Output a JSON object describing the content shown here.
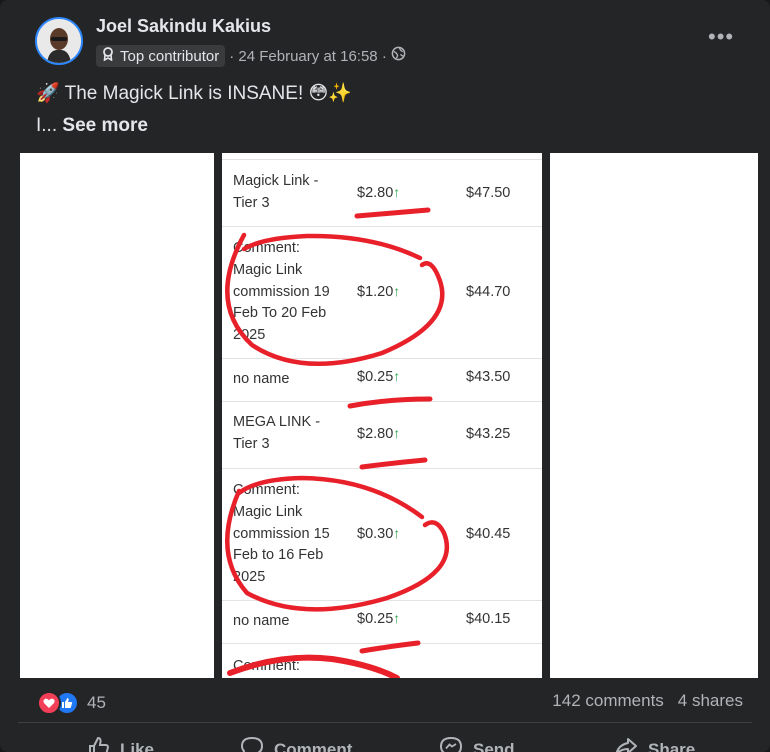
{
  "post": {
    "author": "Joel Sakindu Kakius",
    "badge": "Top contributor",
    "timestamp": "· 24 February at 16:58 ·",
    "text_line1": "🚀 The Magick Link is INSANE! 😳✨",
    "text_line2_prefix": "I... ",
    "see_more": "See more"
  },
  "screenshot_table": {
    "rows": [
      {
        "desc": "Magick Link -\nTier 3",
        "amount": "$2.80",
        "balance": "$47.50"
      },
      {
        "desc": "Comment:\nMagic Link\ncommission 19\nFeb To 20 Feb\n2025",
        "amount": "$1.20",
        "balance": "$44.70"
      },
      {
        "desc": "no name",
        "amount": "$0.25",
        "balance": "$43.50"
      },
      {
        "desc": "MEGA LINK -\nTier 3",
        "amount": "$2.80",
        "balance": "$43.25"
      },
      {
        "desc": "Comment:\nMagic Link\ncommission 15\nFeb to 16 Feb\n2025",
        "amount": "$0.30",
        "balance": "$40.45"
      },
      {
        "desc": "no name",
        "amount": "$0.25",
        "balance": "$40.15"
      },
      {
        "desc": "Comment:",
        "amount": "",
        "balance": ""
      }
    ],
    "up_arrow": "↑"
  },
  "engagement": {
    "reaction_count": "45",
    "comments": "142 comments",
    "shares": "4 shares"
  },
  "actions": {
    "like": "Like",
    "comment": "Comment",
    "send": "Send",
    "share": "Share"
  },
  "icons": {
    "more": "more-options-icon",
    "globe": "globe-icon",
    "badge": "contributor-badge-icon",
    "love": "love-reaction-icon",
    "like": "like-reaction-icon"
  },
  "colors": {
    "card": "#242526",
    "accent": "#2d88ff",
    "ink": "#e8202a",
    "up_arrow": "#2ea44f"
  }
}
